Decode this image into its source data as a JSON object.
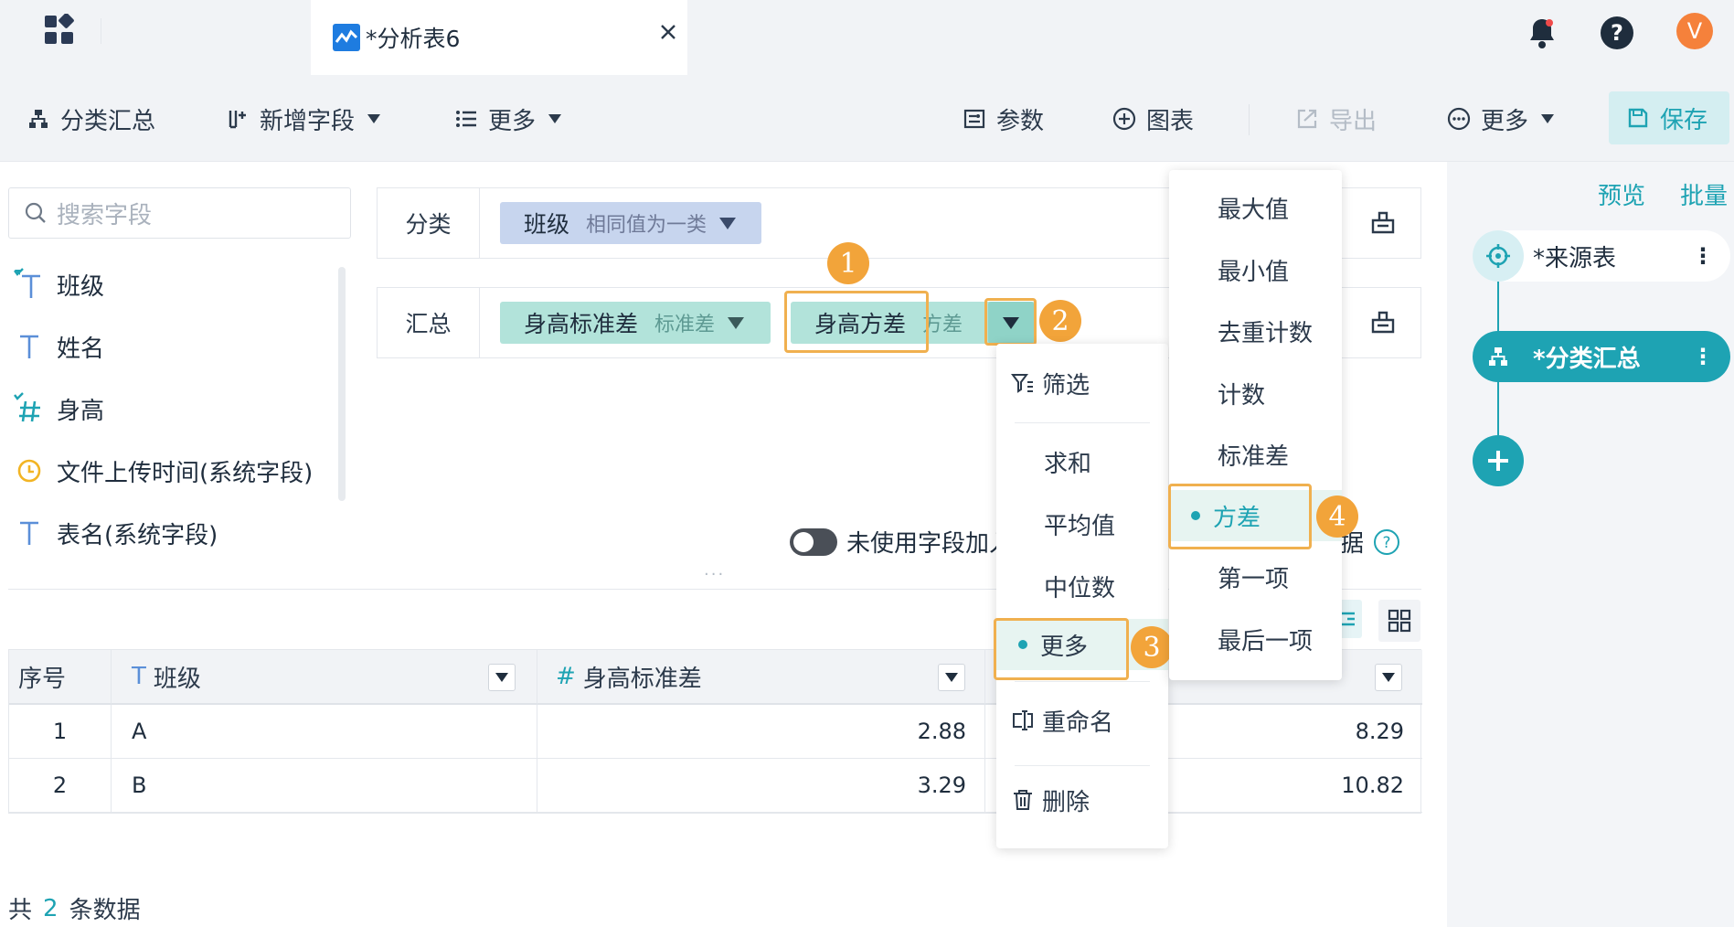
{
  "tab": {
    "title": "*分析表6"
  },
  "user": {
    "avatar_letter": "V"
  },
  "toolbar": {
    "group_summary": "分类汇总",
    "add_field": "新增字段",
    "more_left": "更多",
    "params": "参数",
    "chart": "图表",
    "export": "导出",
    "more_right": "更多",
    "save": "保存"
  },
  "fields_panel": {
    "search_placeholder": "搜索字段",
    "fields": [
      {
        "name": "班级",
        "icon": "text-icon",
        "checked": true
      },
      {
        "name": "姓名",
        "icon": "text-icon",
        "checked": false
      },
      {
        "name": "身高",
        "icon": "number-icon",
        "checked": true
      },
      {
        "name": "文件上传时间(系统字段)",
        "icon": "clock-icon",
        "checked": false
      },
      {
        "name": "表名(系统字段)",
        "icon": "text-icon",
        "checked": false
      }
    ]
  },
  "config": {
    "group_label": "分类",
    "group_chip": {
      "name": "班级",
      "sub": "相同值为一类"
    },
    "summary_label": "汇总",
    "summary_chips": [
      {
        "name": "身高标准差",
        "sub": "标准差"
      },
      {
        "name": "身高方差",
        "sub": "方差"
      }
    ],
    "toggle_label": "未使用字段加入",
    "toggle_tail": "据"
  },
  "menu1": {
    "filter": "筛选",
    "sum": "求和",
    "avg": "平均值",
    "median": "中位数",
    "more": "更多",
    "rename": "重命名",
    "delete": "删除"
  },
  "menu2": {
    "items": [
      "最大值",
      "最小值",
      "去重计数",
      "计数",
      "标准差",
      "方差",
      "第一项",
      "最后一项"
    ],
    "selected": "方差"
  },
  "badges": [
    "1",
    "2",
    "3",
    "4"
  ],
  "table": {
    "headers": [
      "序号",
      "班级",
      "身高标准差"
    ],
    "rows": [
      {
        "idx": "1",
        "class": "A",
        "std": "2.88",
        "var": "8.29"
      },
      {
        "idx": "2",
        "class": "B",
        "std": "3.29",
        "var": "10.82"
      }
    ]
  },
  "footer": {
    "prefix": "共",
    "count": "2",
    "suffix": "条数据"
  },
  "flow": {
    "preview": "预览",
    "batch": "批量",
    "source_node": "*来源表",
    "current_node": "*分类汇总"
  },
  "colors": {
    "accent": "#1ea3b3",
    "highlight": "#f0b04f",
    "badge": "#f2a43a",
    "avatar": "#f5813b"
  }
}
